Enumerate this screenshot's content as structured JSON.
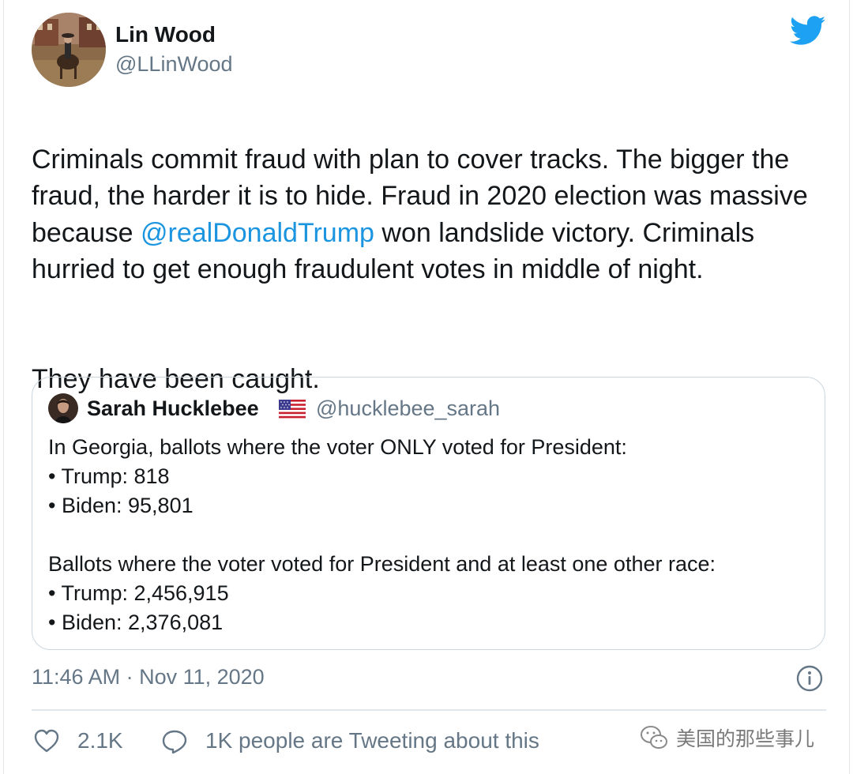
{
  "author": {
    "name": "Lin Wood",
    "handle": "@LLinWood"
  },
  "icons": {
    "brand": "twitter-bird-icon",
    "info": "info-icon",
    "like": "heart-icon",
    "reply": "speech-bubble-icon",
    "watermark": "wechat-icon",
    "flag": "us-flag-icon"
  },
  "colors": {
    "brand": "#1da1f2",
    "mention": "#1b95e0",
    "secondary_text": "#657786",
    "border": "#ccd6dd"
  },
  "tweet": {
    "text_before_mention": "Criminals commit fraud with plan to cover tracks. The bigger the fraud, the harder it is to hide. Fraud in 2020 election was massive because ",
    "mention": "@realDonaldTrump",
    "text_after_mention": " won landslide victory. Criminals hurried to get enough fraudulent votes in middle of night.",
    "second_paragraph": "They have been caught."
  },
  "quoted_tweet": {
    "name": "Sarah Hucklebee",
    "handle": "@hucklebee_sarah",
    "lines": [
      "In Georgia, ballots where the voter ONLY voted for President:",
      "• Trump: 818",
      "• Biden: 95,801",
      "",
      "Ballots where the voter voted for President and at least one other race:",
      "• Trump: 2,456,915",
      "• Biden: 2,376,081"
    ]
  },
  "footer": {
    "timestamp": "11:46 AM · Nov 11, 2020",
    "likes": "2.1K",
    "retweet_text": "1K people are Tweeting about this"
  },
  "watermark": {
    "text": "美国的那些事儿"
  }
}
